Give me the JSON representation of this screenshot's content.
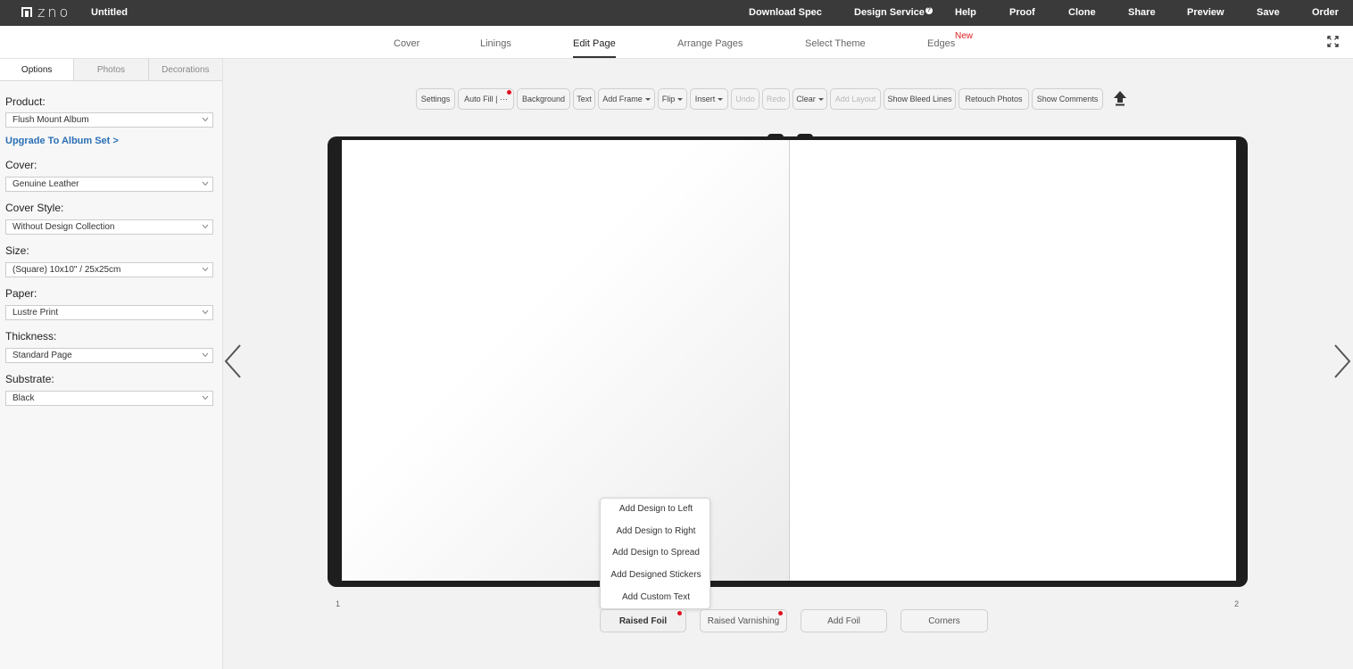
{
  "app": {
    "logo_text": "ZNO",
    "document_title": "Untitled"
  },
  "top_menu": {
    "download_spec": "Download Spec",
    "design_service": "Design Service",
    "design_service_badge": "?",
    "help": "Help",
    "proof": "Proof",
    "clone": "Clone",
    "share": "Share",
    "preview": "Preview",
    "save": "Save",
    "order": "Order"
  },
  "tabs": {
    "cover": "Cover",
    "linings": "Linings",
    "edit_page": "Edit Page",
    "arrange_pages": "Arrange Pages",
    "select_theme": "Select Theme",
    "edges": "Edges",
    "new_badge": "New",
    "active": "Edit Page"
  },
  "sidebar": {
    "tabs": [
      "Options",
      "Photos",
      "Decorations"
    ],
    "upgrade_link": "Upgrade To Album Set >",
    "fields": [
      {
        "label": "Product:",
        "value": "Flush Mount Album"
      },
      {
        "label": "Cover:",
        "value": "Genuine Leather"
      },
      {
        "label": "Cover Style:",
        "value": "Without Design Collection"
      },
      {
        "label": "Size:",
        "value": "(Square) 10x10\" / 25x25cm"
      },
      {
        "label": "Paper:",
        "value": "Lustre Print"
      },
      {
        "label": "Thickness:",
        "value": "Standard Page"
      },
      {
        "label": "Substrate:",
        "value": "Black"
      }
    ]
  },
  "toolbar": {
    "settings": "Settings",
    "auto_fill": "Auto Fill",
    "auto_fill_more": "| ···",
    "background": "Background",
    "text": "Text",
    "add_frame": "Add Frame",
    "flip": "Flip",
    "insert": "Insert",
    "undo": "Undo",
    "redo": "Redo",
    "clear": "Clear",
    "add_layout": "Add Layout",
    "show_bleed_lines": "Show Bleed Lines",
    "retouch_photos": "Retouch Photos",
    "show_comments": "Show Comments"
  },
  "canvas": {
    "left_page_number": "1",
    "right_page_number": "2"
  },
  "popup_menu": {
    "items": [
      "Add Design to Left",
      "Add Design to Right",
      "Add Design to Spread",
      "Add Designed Stickers",
      "Add Custom Text"
    ]
  },
  "bottom_buttons": {
    "raised_foil": "Raised Foil",
    "raised_varnishing": "Raised Varnishing",
    "add_foil": "Add Foil",
    "corners": "Corners"
  },
  "colors": {
    "topbar": "#3a3a3a",
    "link": "#2a6fb5",
    "badge_red": "#e02020",
    "book_frame": "#1e1e1e"
  }
}
